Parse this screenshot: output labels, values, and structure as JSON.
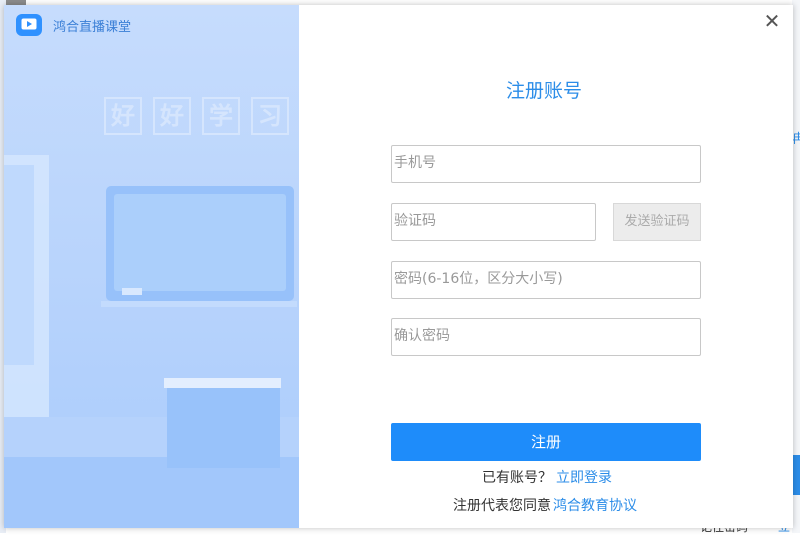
{
  "background": {
    "right_link_fragment": "冉",
    "bottom_text_fragment": "记住密码",
    "bottom_link_fragment": "立",
    "accent": "#2c8de8"
  },
  "dialog": {
    "app_title": "鸿合直播课堂",
    "app_icon": "play-icon",
    "close_label": "✕",
    "decor_chars": [
      "好",
      "好",
      "学",
      "习"
    ],
    "form_title": "注册账号",
    "fields": {
      "phone_placeholder": "手机号",
      "code_placeholder": "验证码",
      "password_placeholder": "密码(6-16位，区分大小写)",
      "confirm_placeholder": "确认密码"
    },
    "send_code_label": "发送验证码",
    "register_label": "注册",
    "have_account_text": "已有账号？",
    "login_link": "立即登录",
    "agree_text": "注册代表您同意",
    "agreement_link": "鸿合教育协议",
    "colors": {
      "primary": "#1e8cfa",
      "panel": "#b7d3fc"
    }
  }
}
